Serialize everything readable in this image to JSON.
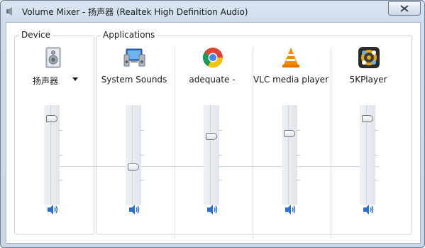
{
  "window": {
    "title": "Volume Mixer - 扬声器 (Realtek High Definition Audio)"
  },
  "device_group": {
    "label": "Device",
    "device": {
      "name": "扬声器",
      "icon": "speaker-device-icon",
      "volume_percent": 100
    }
  },
  "applications_group": {
    "label": "Applications",
    "apps": [
      {
        "name": "System Sounds",
        "icon": "system-sounds-icon",
        "volume_percent": 40
      },
      {
        "name": "adequate -",
        "icon": "chrome-icon",
        "volume_percent": 78
      },
      {
        "name": "VLC media player",
        "icon": "vlc-icon",
        "volume_percent": 82
      },
      {
        "name": "5KPlayer",
        "icon": "5kplayer-icon",
        "volume_percent": 100
      }
    ]
  },
  "colors": {
    "accent": "#2a6fc9",
    "window_frame": "#c9d7e8"
  }
}
